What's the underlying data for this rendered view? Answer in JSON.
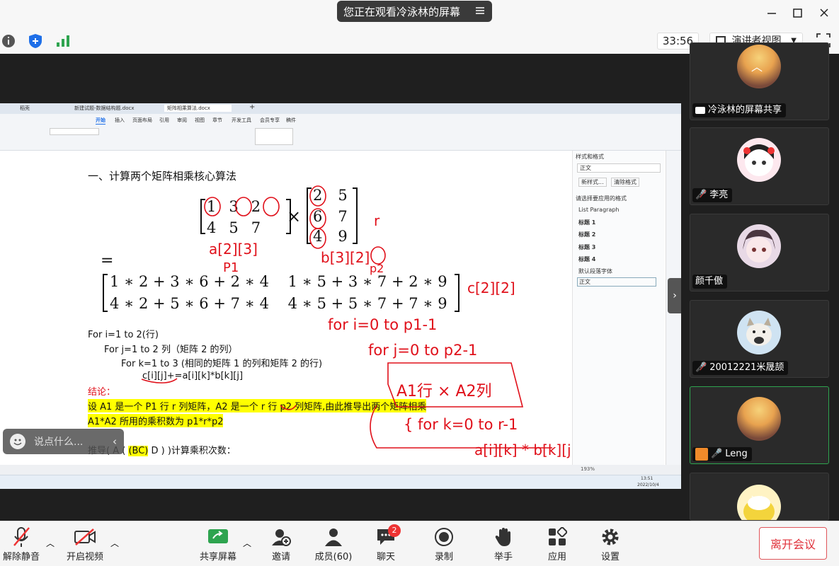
{
  "banner": {
    "text": "您正在观看冷泳林的屏幕",
    "menu_icon": "menu-icon"
  },
  "toolbar": {
    "timer": "33:56",
    "view_mode": "演讲者视图"
  },
  "participants": [
    {
      "name": "冷泳林的屏幕共享",
      "muted": false,
      "share": true
    },
    {
      "name": "李亮",
      "muted": true
    },
    {
      "name": "颜千傲",
      "muted": false
    },
    {
      "name": "20012221米晟颉",
      "muted": true
    },
    {
      "name": "Leng",
      "muted": false,
      "active": true
    },
    {
      "name": "",
      "muted": false
    }
  ],
  "bottom": {
    "unmute": "解除静音",
    "video": "开启视频",
    "share": "共享屏幕",
    "invite": "邀请",
    "members": "成员(60)",
    "chat": "聊天",
    "chat_badge": "2",
    "record": "录制",
    "raise": "举手",
    "apps": "应用",
    "settings": "设置",
    "leave": "离开会议"
  },
  "chat_box": {
    "placeholder": "说点什么..."
  },
  "doc": {
    "tabs": [
      "稻壳",
      "新建试题-数据结构题.docx",
      "矩阵相乘算法.docx"
    ],
    "ribbon_tabs": [
      "开始",
      "插入",
      "页面布局",
      "引用",
      "审阅",
      "视图",
      "章节",
      "开发工具",
      "会员专享",
      "稿件"
    ],
    "heading": "一、计算两个矩阵相乘核心算法",
    "m1_row1": [
      "1",
      "3",
      "2"
    ],
    "m1_row2": [
      "4",
      "5",
      "7"
    ],
    "m2_rows": [
      [
        "2",
        "5"
      ],
      [
        "6",
        "7"
      ],
      [
        "4",
        "9"
      ]
    ],
    "times": "×",
    "equals": "=",
    "res_row1": "1 ∗ 2 + 3 ∗ 6 + 2 ∗ 4    1 ∗ 5 + 3 ∗ 7 + 2 ∗ 9",
    "res_row2": "4 ∗ 2 + 5 ∗ 6 + 7 ∗ 4    4 ∗ 5 + 5 ∗ 7 + 7 ∗ 9",
    "for1": "For i=1 to 2(行)",
    "for2": "For j=1 to 2  列（矩阵 2 的列）",
    "for3": "For k=1 to 3 (相同的矩阵 1 的列和矩阵 2 的行)",
    "inner": "c[i][j]+=a[i][k]*b[k][j]",
    "conclusion": "结论：",
    "line1": "设 A1 是一个 P1 行 r 列矩阵，A2 是一个 r 行 p2 列矩阵,由此推导出两个矩阵相乘",
    "line2": "A1*A2 所用的乘积数为 p1*r*p2",
    "line3a": "推导( A ( ",
    "line3b": "(BC)",
    "line3c": " D ) )计算乘积次数：",
    "side_title": "样式和格式",
    "side_style": "正文",
    "side_btn1": "新样式...",
    "side_btn2": "清除格式",
    "side_label": "请选择要应用的格式",
    "side_items": [
      "List Paragraph",
      "标题 1",
      "标题 2",
      "标题 3",
      "标题 4",
      "默认段落字体",
      "正文"
    ],
    "zoom": "193%",
    "time": "13:51",
    "date": "2022/10/4"
  },
  "ink": {
    "a_dims": "a[2][3]",
    "p1": "P1",
    "b_dims": "b[3][2]",
    "r": "r",
    "p2": "p2",
    "c_dims": "c[2][2]",
    "for_i": "for i=0 to p1-1",
    "for_j": "for j=0 to p2-1",
    "box": "A1行 × A2列",
    "for_k": "{ for k=0 to r-1",
    "prod": "a[i][k] * b[k][j]"
  },
  "colors": {
    "ink": "#e0101a",
    "highlight": "#ffff00",
    "accent": "#e0303a",
    "green": "#2ea44f"
  }
}
